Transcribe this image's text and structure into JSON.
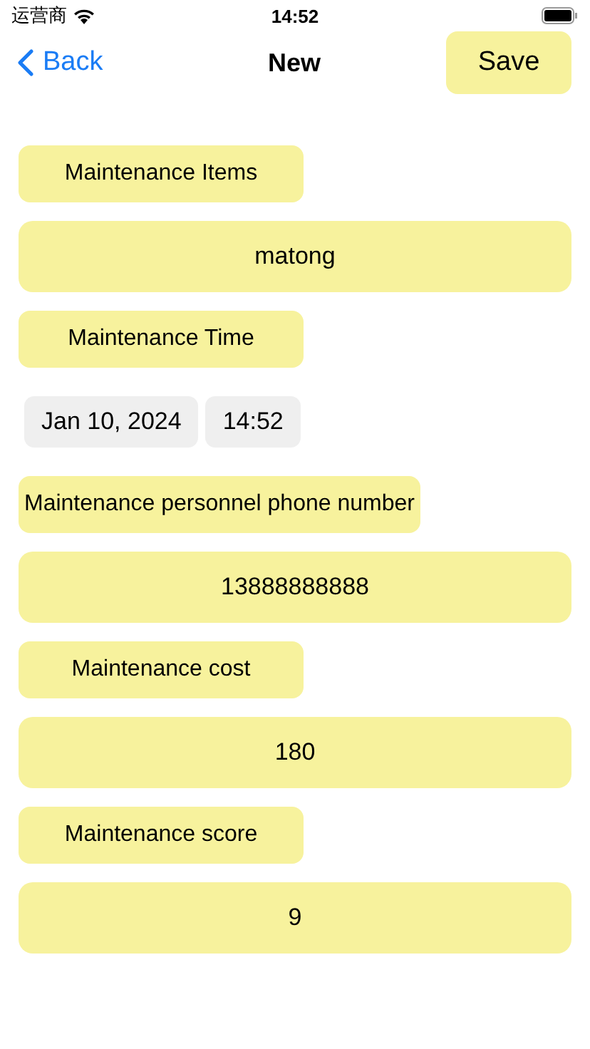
{
  "status_bar": {
    "carrier": "运营商",
    "time": "14:52"
  },
  "nav": {
    "back": "Back",
    "title": "New",
    "action": "Save"
  },
  "rows": [
    {
      "kind": "label",
      "text": "Maintenance Items"
    },
    {
      "kind": "value",
      "text": "matong"
    },
    {
      "kind": "label",
      "text": "Maintenance Time"
    },
    {
      "kind": "datetime",
      "date": "Jan 10, 2024",
      "time": "14:52"
    },
    {
      "kind": "label",
      "text": "Maintenance personnel phone number"
    },
    {
      "kind": "value",
      "text": "13888888888"
    },
    {
      "kind": "label",
      "text": "Maintenance cost"
    },
    {
      "kind": "value",
      "text": "180"
    },
    {
      "kind": "label",
      "text": "Maintenance score"
    },
    {
      "kind": "value",
      "text": "9"
    }
  ]
}
